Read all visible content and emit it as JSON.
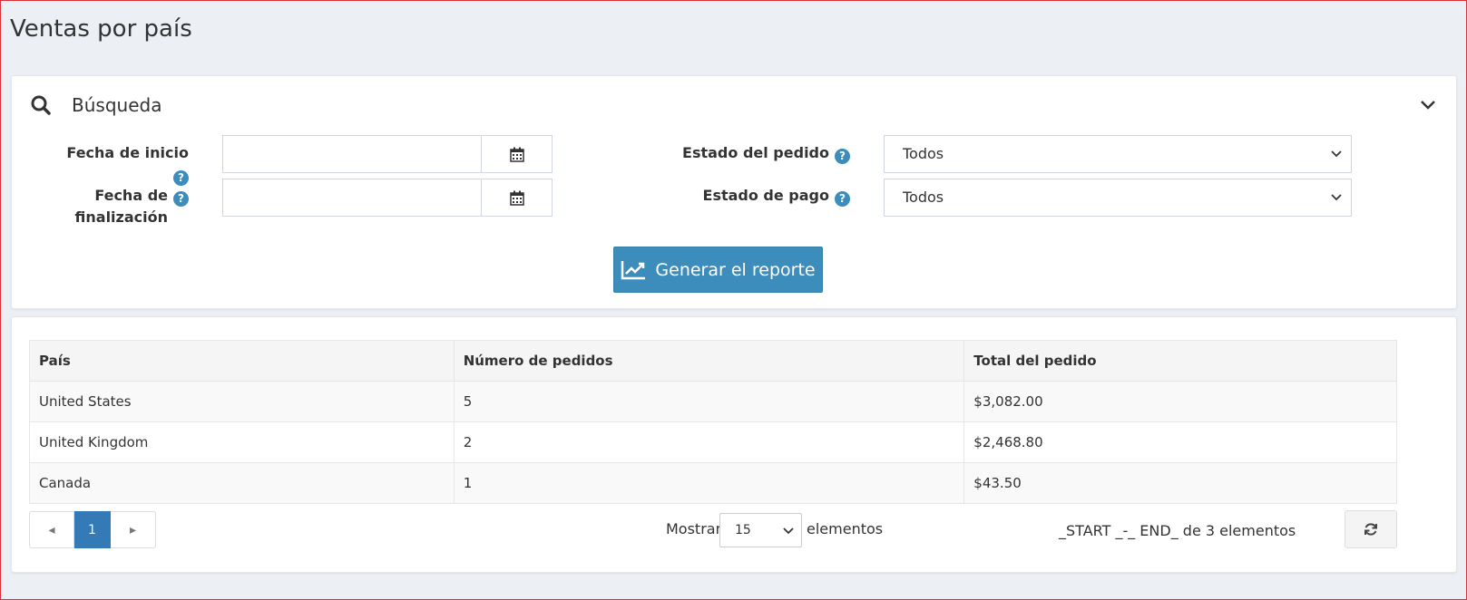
{
  "page": {
    "title": "Ventas por país"
  },
  "search": {
    "title": "Búsqueda",
    "start_date": {
      "label": "Fecha de inicio",
      "value": ""
    },
    "end_date": {
      "label_line1": "Fecha de",
      "label_line2": "finalización",
      "value": ""
    },
    "order_status": {
      "label": "Estado del pedido",
      "selected": "Todos"
    },
    "payment_status": {
      "label": "Estado de pago",
      "selected": "Todos"
    },
    "help_glyph": "?",
    "generate_button": "Generar el reporte"
  },
  "table": {
    "headers": [
      "País",
      "Número de pedidos",
      "Total del pedido"
    ],
    "rows": [
      [
        "United States",
        "5",
        "$3,082.00"
      ],
      [
        "United Kingdom",
        "2",
        "$2,468.80"
      ],
      [
        "Canada",
        "1",
        "$43.50"
      ]
    ]
  },
  "pagination": {
    "prev": "◂",
    "current_page": "1",
    "next": "▸",
    "show_label": "Mostrar",
    "page_size": "15",
    "elements_label": "elementos",
    "info": "_START _-_ END_ de 3 elementos"
  },
  "colors": {
    "accent": "#3c8dbc",
    "pager_active": "#337ab7"
  }
}
